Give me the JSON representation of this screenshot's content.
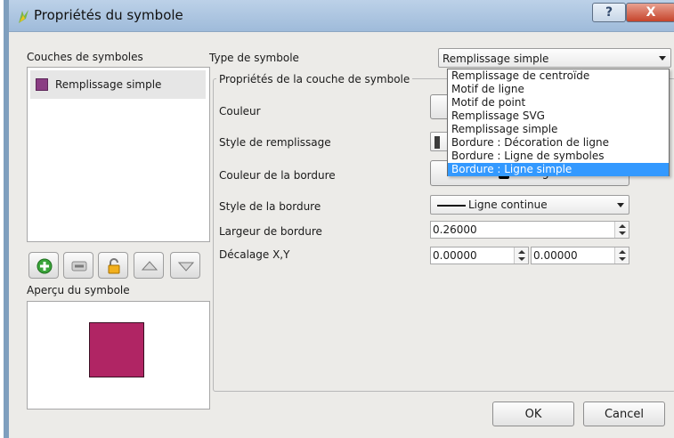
{
  "window": {
    "title": "Propriétés du symbole",
    "help_label": "?",
    "close_label": "X"
  },
  "left": {
    "layers_title": "Couches de symboles",
    "layers": [
      {
        "label": "Remplissage simple",
        "color": "#8a3d83"
      }
    ],
    "preview_title": "Aperçu du symbole",
    "preview_color": "#b02564"
  },
  "right": {
    "symbol_type_label": "Type de symbole",
    "symbol_type_value": "Remplissage simple",
    "layer_props_title": "Propriétés de la couche de symbole",
    "color_label": "Couleur",
    "fill_style_label": "Style de remplissage",
    "border_color_label": "Couleur de la bordure",
    "border_color_button": "Changer",
    "border_style_label": "Style de la bordure",
    "border_style_value": "Ligne continue",
    "border_width_label": "Largeur de bordure",
    "border_width_value": "0.26000",
    "offset_label": "Décalage X,Y",
    "offset_x": "0.00000",
    "offset_y": "0.00000"
  },
  "dropdown": {
    "options": [
      "Remplissage de centroïde",
      "Motif de ligne",
      "Motif de point",
      "Remplissage SVG",
      "Remplissage simple",
      "Bordure : Décoration de ligne",
      "Bordure : Ligne de symboles",
      "Bordure : Ligne simple"
    ],
    "selected": "Bordure : Ligne simple"
  },
  "buttons": {
    "ok": "OK",
    "cancel": "Cancel"
  }
}
